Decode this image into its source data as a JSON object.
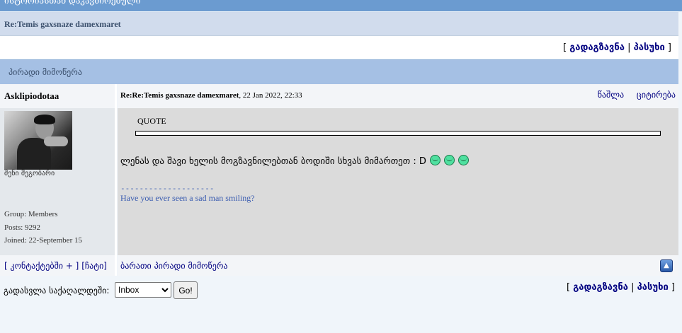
{
  "forum": {
    "top_bar_text": "ისტორიასთან დაკავშირებული"
  },
  "topic": {
    "title": "Re:Temis gaxsnaze damexmaret"
  },
  "actions": {
    "open_bracket": "[",
    "forward_label": "გადაგზავნა",
    "separator": "|",
    "reply_label": "პასუხი",
    "close_bracket": "]"
  },
  "pm_bar": {
    "title": "პირადი მიმოწერა"
  },
  "post": {
    "author": "Asklipiodotaa",
    "subject": "Re:Re:Temis gaxsnaze damexmaret",
    "date": ", 22 Jan 2022, 22:33",
    "delete_label": "წაშლა",
    "quote_label": "ციტირება",
    "member_title": "შენი მეგობარი",
    "group": "Group: Members",
    "posts": "Posts: 9292",
    "joined": "Joined: 22-September 15",
    "quote_heading": "QUOTE",
    "body_text": "ლენას და შავი ხელის მოგზავნილებთან ბოდიში სხვას მიმართეთ : D",
    "signature_dashes": "--------------------",
    "signature_text": "Have you ever seen a sad man smiling?"
  },
  "post_footer": {
    "contacts_link": "[ კონტაქტებში + ]",
    "chat_link": "[ჩატი]",
    "open_pm_link": "ბარათი პირადი მიმოწერა"
  },
  "bottom": {
    "goto_label": "გადასვლა საქაღალდეში:",
    "folder_selected": "Inbox",
    "go_label": "Go!"
  },
  "icons": {
    "smiley": "smiley-icon",
    "top": "scroll-top-icon"
  }
}
